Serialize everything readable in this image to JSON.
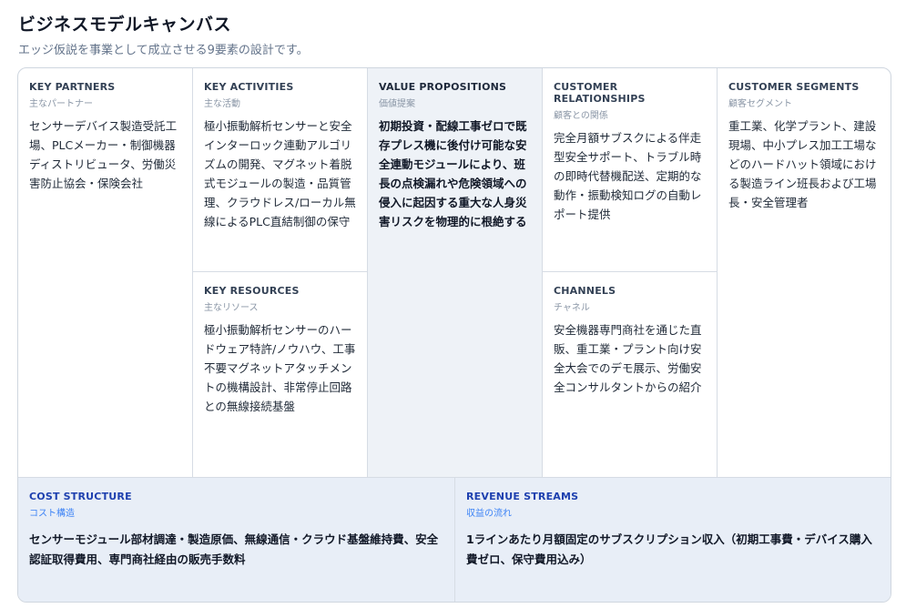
{
  "page": {
    "title": "ビジネスモデルキャンバス",
    "subtitle": "エッジ仮説を事業として成立させる9要素の設計です。"
  },
  "canvas": {
    "key_partners": {
      "label": "KEY PARTNERS",
      "sublabel": "主なパートナー",
      "text": "センサーデバイス製造受託工場、PLCメーカー・制御機器ディストリビュータ、労働災害防止協会・保険会社"
    },
    "key_activities": {
      "label": "KEY ACTIVITIES",
      "sublabel": "主な活動",
      "text": "極小振動解析センサーと安全インターロック連動アルゴリズムの開発、マグネット着脱式モジュールの製造・品質管理、クラウドレス/ローカル無線によるPLC直結制御の保守"
    },
    "key_resources": {
      "label": "KEY RESOURCES",
      "sublabel": "主なリソース",
      "text": "極小振動解析センサーのハードウェア特許/ノウハウ、工事不要マグネットアタッチメントの機構設計、非常停止回路との無線接続基盤"
    },
    "value_propositions": {
      "label": "VALUE PROPOSITIONS",
      "sublabel": "価値提案",
      "text": "初期投資・配線工事ゼロで既存プレス機に後付け可能な安全連動モジュールにより、班長の点検漏れや危険領域への侵入に起因する重大な人身災害リスクを物理的に根絶する"
    },
    "customer_relationships": {
      "label": "CUSTOMER RELATIONSHIPS",
      "sublabel": "顧客との関係",
      "text": "完全月額サブスクによる伴走型安全サポート、トラブル時の即時代替機配送、定期的な動作・振動検知ログの自動レポート提供"
    },
    "channels": {
      "label": "CHANNELS",
      "sublabel": "チャネル",
      "text": "安全機器専門商社を通じた直販、重工業・プラント向け安全大会でのデモ展示、労働安全コンサルタントからの紹介"
    },
    "customer_segments": {
      "label": "CUSTOMER SEGMENTS",
      "sublabel": "顧客セグメント",
      "text": "重工業、化学プラント、建設現場、中小プレス加工工場などのハードハット領域における製造ライン班長および工場長・安全管理者"
    },
    "cost_structure": {
      "label": "COST STRUCTURE",
      "sublabel": "コスト構造",
      "text": "センサーモジュール部材調達・製造原価、無線通信・クラウド基盤維持費、安全認証取得費用、専門商社経由の販売手数料"
    },
    "revenue_streams": {
      "label": "REVENUE STREAMS",
      "sublabel": "収益の流れ",
      "text": "1ラインあたり月額固定のサブスクリプション収入（初期工事費・デバイス購入費ゼロ、保守費用込み）"
    }
  }
}
